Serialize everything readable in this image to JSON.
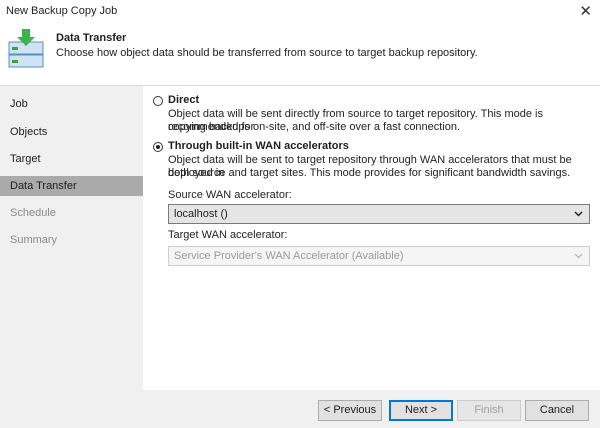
{
  "window": {
    "title": "New Backup Copy Job",
    "close_glyph": "✕"
  },
  "header": {
    "icon": "backup-copy-icon",
    "title": "Data Transfer",
    "subtitle": "Choose how object data should be transferred from source to target backup repository."
  },
  "sidebar": {
    "items": [
      {
        "label": "Job",
        "state": "normal"
      },
      {
        "label": "Objects",
        "state": "normal"
      },
      {
        "label": "Target",
        "state": "normal"
      },
      {
        "label": "Data Transfer",
        "state": "active"
      },
      {
        "label": "Schedule",
        "state": "disabled"
      },
      {
        "label": "Summary",
        "state": "disabled"
      }
    ]
  },
  "options": {
    "direct": {
      "label": "Direct",
      "selected": false,
      "description_line1": "Object data will be sent directly from source to target repository. This mode is recommended for",
      "description_line2": "copying backups on-site, and off-site over a fast connection."
    },
    "wan": {
      "label": "Through built-in WAN accelerators",
      "selected": true,
      "description_line1": "Object data will be sent to target repository through WAN accelerators that must be deployed in",
      "description_line2": "both source and target sites. This mode provides for significant bandwidth savings."
    }
  },
  "source_wan": {
    "label": "Source WAN accelerator:",
    "value": "localhost ()"
  },
  "target_wan": {
    "label": "Target WAN accelerator:",
    "value": "Service Provider's WAN Accelerator (Available)",
    "disabled": true
  },
  "buttons": {
    "previous": "< Previous",
    "next": "Next >",
    "finish": "Finish",
    "cancel": "Cancel"
  }
}
